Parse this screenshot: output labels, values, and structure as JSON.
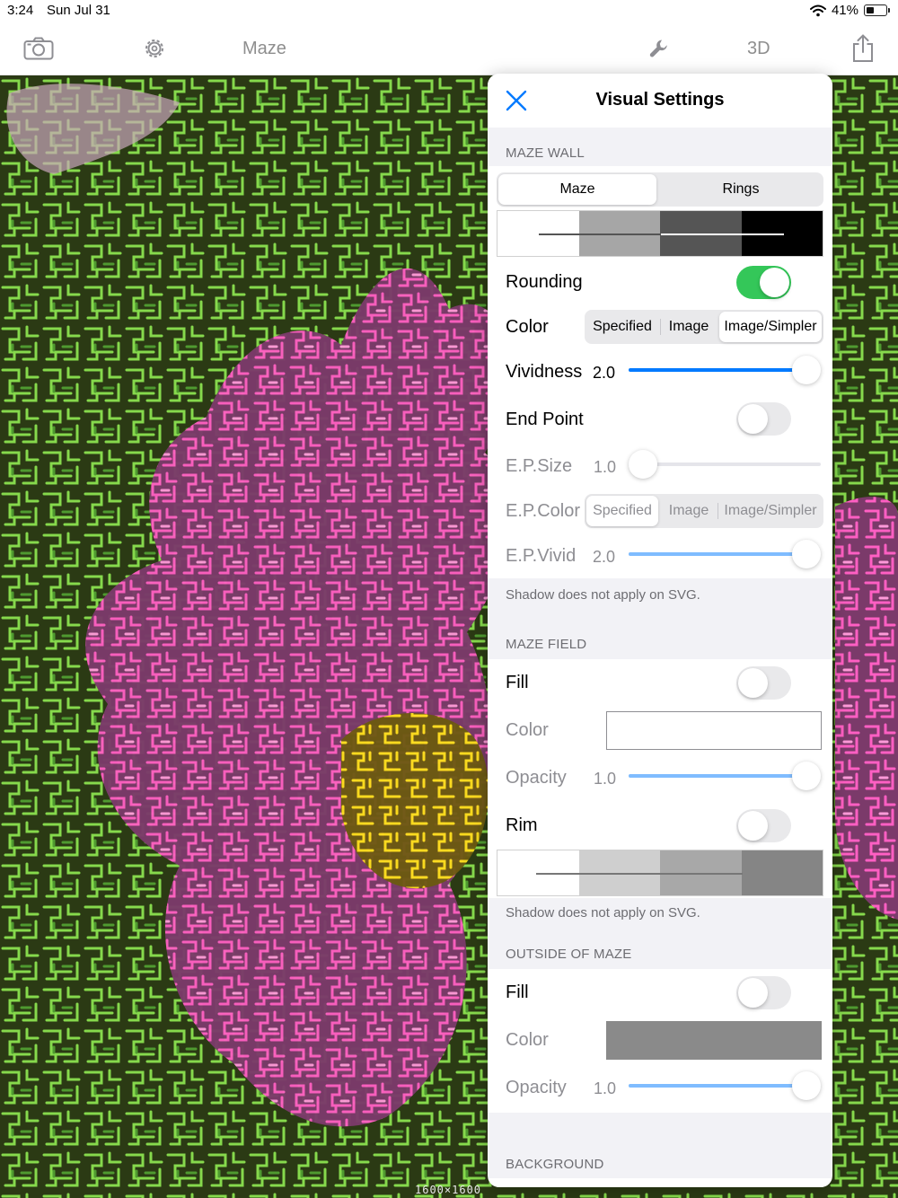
{
  "status_bar": {
    "time": "3:24",
    "date": "Sun Jul 31",
    "battery_percent": "41%",
    "battery_level": 0.41
  },
  "toolbar": {
    "title": "Maze",
    "mode_3d_label": "3D"
  },
  "image_size_label": "1600×1600",
  "panel": {
    "title": "Visual Settings",
    "maze_wall": {
      "header": "MAZE WALL",
      "wall_type_options": [
        "Maze",
        "Rings"
      ],
      "wall_type_selected": "Maze",
      "width_steps": [
        "#ffffff",
        "#a6a6a6",
        "#555555",
        "#000000"
      ],
      "rounding_label": "Rounding",
      "rounding_on": true,
      "color_label": "Color",
      "color_options": [
        "Specified",
        "Image",
        "Image/Simpler"
      ],
      "color_selected": "Image/Simpler",
      "vividness_label": "Vividness",
      "vividness_value": "2.0",
      "vividness_level": 1.0,
      "end_point_label": "End Point",
      "end_point_on": false,
      "ep_size_label": "E.P.Size",
      "ep_size_value": "1.0",
      "ep_size_level": 0.0,
      "ep_color_label": "E.P.Color",
      "ep_color_options": [
        "Specified",
        "Image",
        "Image/Simpler"
      ],
      "ep_color_selected": "Specified",
      "ep_vivid_label": "E.P.Vivid",
      "ep_vivid_value": "2.0",
      "ep_vivid_level": 1.0,
      "footnote": "Shadow does not apply on SVG."
    },
    "maze_field": {
      "header": "MAZE FIELD",
      "fill_label": "Fill",
      "fill_on": false,
      "color_label": "Color",
      "color_swatch": "#ffffff",
      "opacity_label": "Opacity",
      "opacity_value": "1.0",
      "opacity_level": 1.0,
      "rim_label": "Rim",
      "rim_on": false,
      "rim_steps": [
        "#ffffff",
        "#cfcfcf",
        "#a8a8a8",
        "#858585"
      ],
      "footnote": "Shadow does not apply on SVG."
    },
    "outside_of_maze": {
      "header": "OUTSIDE OF MAZE",
      "fill_label": "Fill",
      "fill_on": false,
      "color_label": "Color",
      "color_swatch": "#8a8a8a",
      "opacity_label": "Opacity",
      "opacity_value": "1.0",
      "opacity_level": 1.0
    },
    "background": {
      "header": "BACKGROUND"
    }
  },
  "icons": {
    "camera": "camera-icon",
    "settings": "gear-icon",
    "visual_settings": "wrench-icon",
    "share": "share-icon",
    "close": "close-icon",
    "wifi": "wifi-icon",
    "battery": "battery-icon"
  },
  "colors": {
    "accent": "#007aff",
    "toggle_on": "#34c759",
    "maze_green": "#7fd64a",
    "maze_pink": "#ff4fb8",
    "maze_yellow": "#ffe11a"
  }
}
